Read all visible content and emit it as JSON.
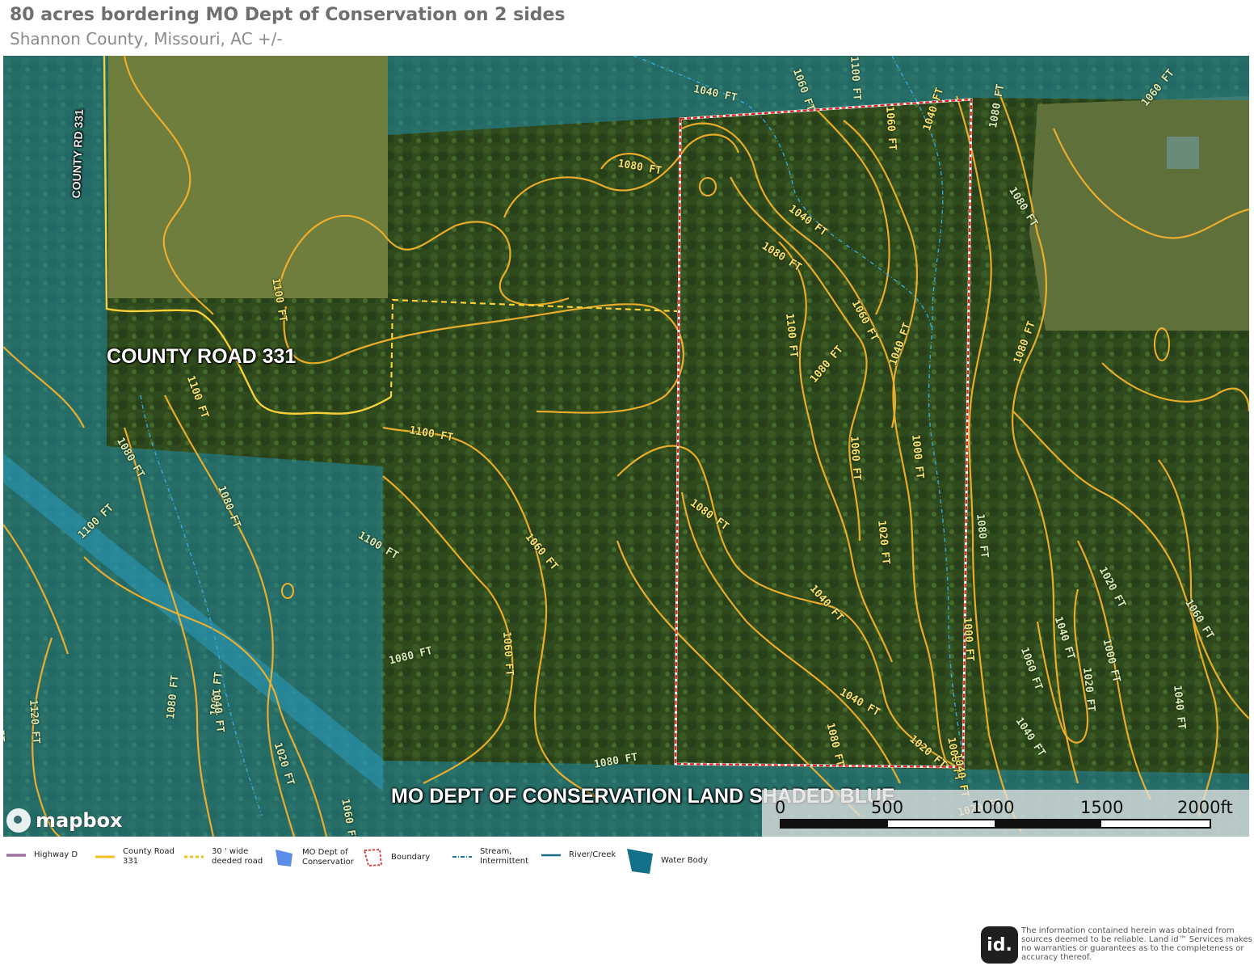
{
  "header": {
    "title": "80 acres bordering MO Dept of Conservation on 2 sides",
    "subtitle": "Shannon County, Missouri,  AC +/-"
  },
  "map": {
    "labels": {
      "county_road": "COUNTY ROAD 331",
      "conservation_note": "MO DEPT OF CONSERVATION LAND SHADED BLUE",
      "vertical_road": "COUNTY RD 331"
    },
    "contours": [
      "1040 FT",
      "1060 FT",
      "1100 FT",
      "1060 FT",
      "1040 FT",
      "1040 FT",
      "1080 FT",
      "1080 FT",
      "1100 FT",
      "1060 FT",
      "1100 FT",
      "1080 FT",
      "1080 FT",
      "1040 FT",
      "1060 FT",
      "1000 FT",
      "1080 FT",
      "1080 FT",
      "1060 FT",
      "1100 FT",
      "1020 FT",
      "1040 FT",
      "1040 FT",
      "1000 FT",
      "1020 FT",
      "1060 FT",
      "1040 FT",
      "1080 FT",
      "1060 FT",
      "1080 FT",
      "1040 FT",
      "1020 FT",
      "1080 FT",
      "1000 FT",
      "1040 FT",
      "1060 FT",
      "1020 FT",
      "1100 FT",
      "1060 FT",
      "1080 FT",
      "1080 FT",
      "1100 FT",
      "1080 FT",
      "1100 FT",
      "1120 FT",
      "1080 FT",
      "1060 FT",
      "1040 FT",
      "1020 FT",
      "1060 FT",
      "1100 FT",
      "1000 FT",
      "1040 FT",
      "1020 FT",
      "1080 FT"
    ],
    "scale": {
      "ticks": [
        "0",
        "500",
        "1000",
        "1500",
        "2000ft"
      ]
    },
    "attribution": "mapbox"
  },
  "legend": [
    {
      "label": "Highway D",
      "symbol": "line",
      "color": "#6a2a6a"
    },
    {
      "label": "County Road 331",
      "symbol": "line",
      "color": "#f0c020"
    },
    {
      "label": "30 '  wide deeded road",
      "symbol": "dashed",
      "color": "#f0c020"
    },
    {
      "label": "MO Dept of Conservatior",
      "symbol": "polygon",
      "color": "#5b8de8"
    },
    {
      "label": "Boundary",
      "symbol": "outline",
      "color": "#e23030"
    },
    {
      "label": "Stream, Intermittent",
      "symbol": "dashdot",
      "color": "#1a78a8"
    },
    {
      "label": "River/Creek",
      "symbol": "line",
      "color": "#1a6a8a"
    },
    {
      "label": "Water Body",
      "symbol": "polygon",
      "color": "#137088"
    }
  ],
  "footer": {
    "badge": "id.",
    "disclaimer": "The information contained herein was obtained from sources deemed to be reliable. Land id™ Services makes no warranties or guarantees as to the completeness or accuracy thereof."
  }
}
